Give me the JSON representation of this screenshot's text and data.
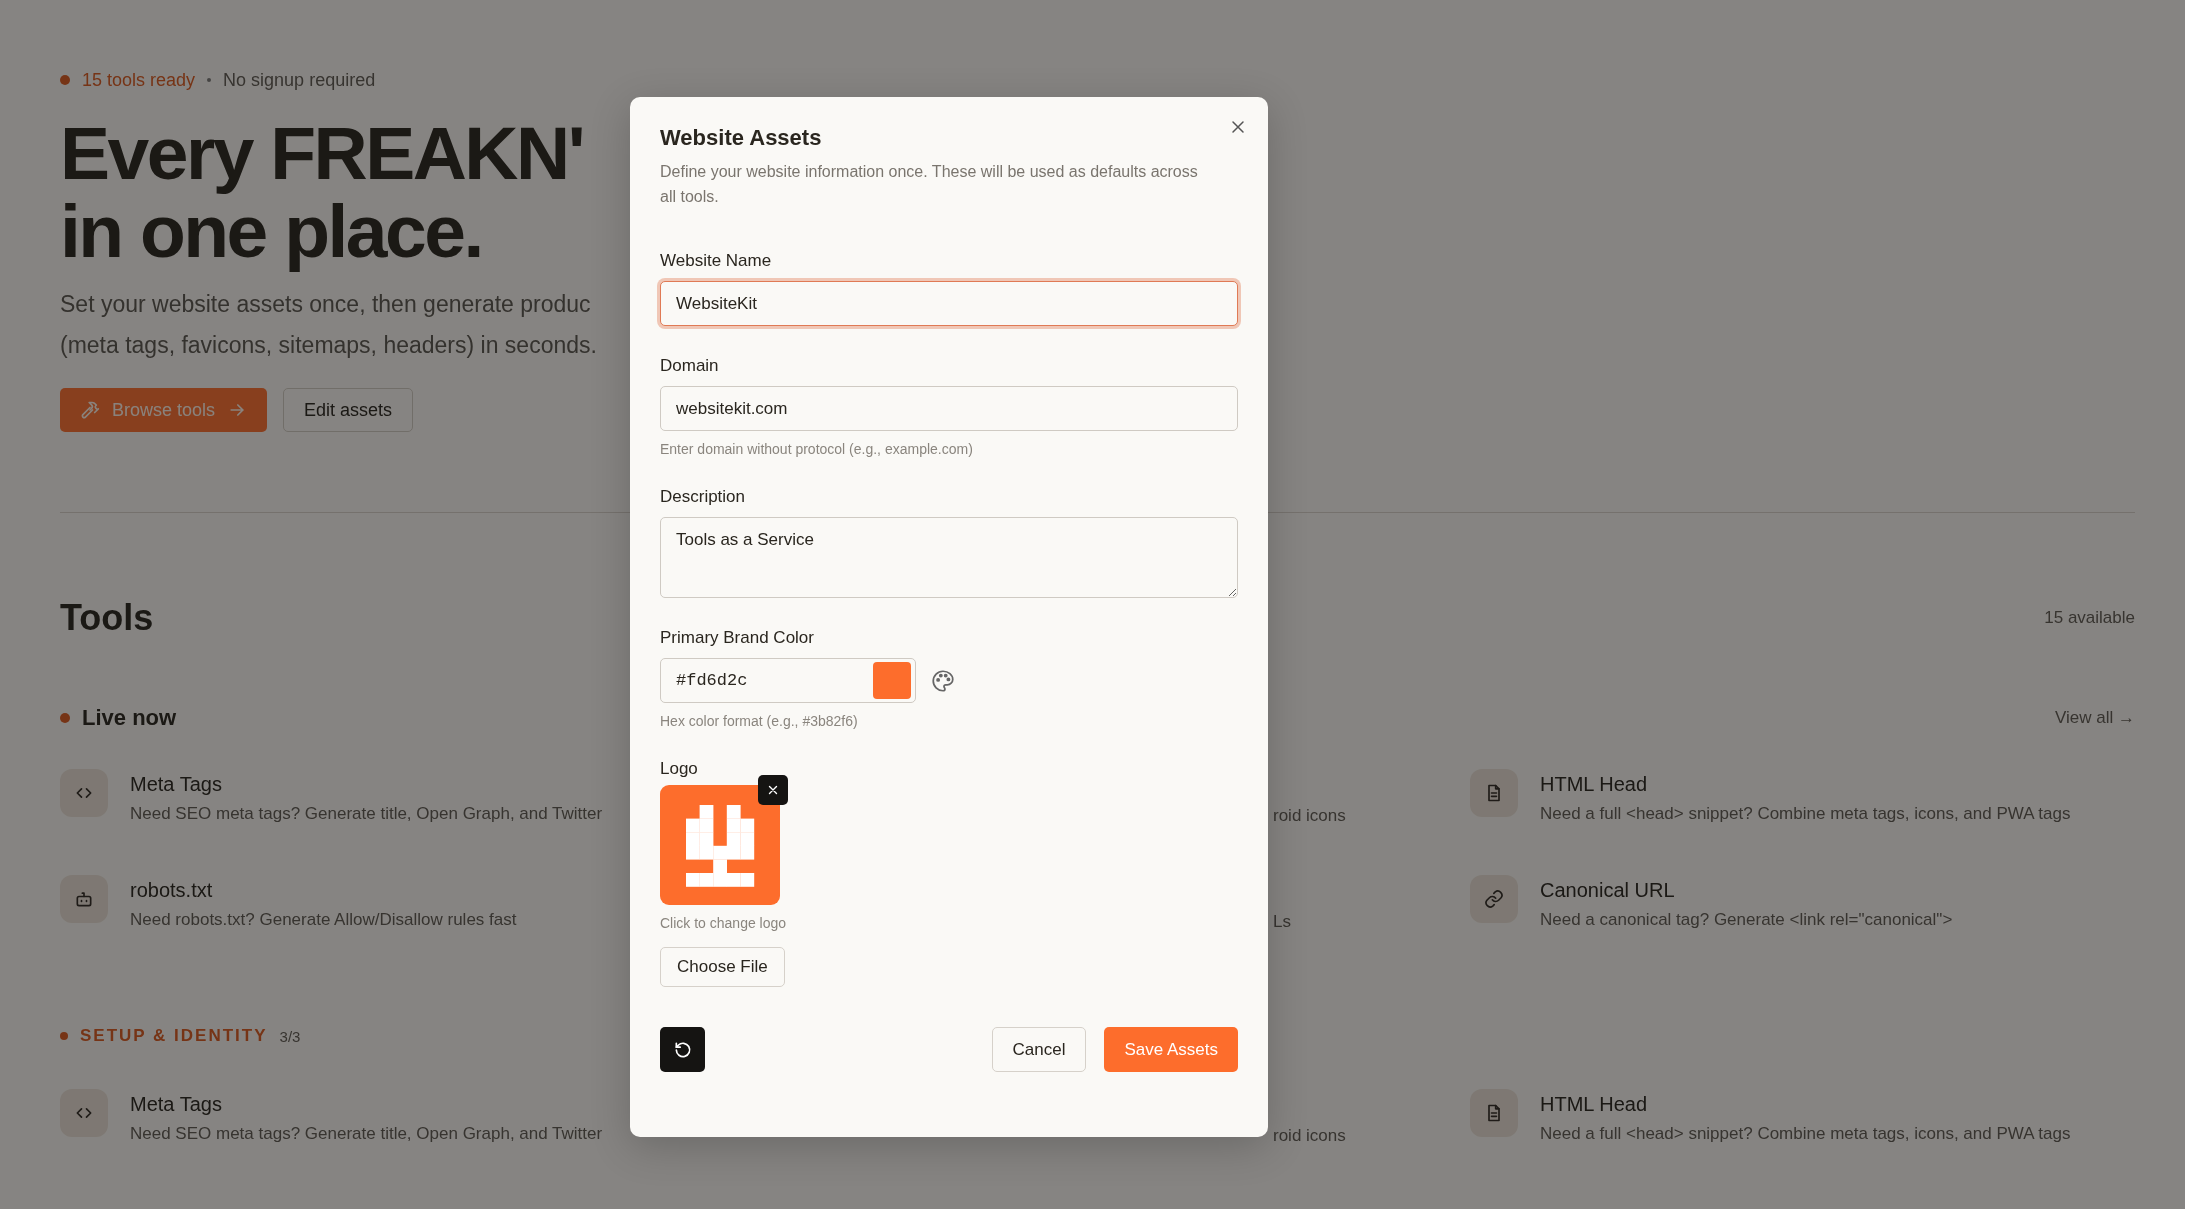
{
  "hero": {
    "status": "15 tools ready",
    "note": "No signup required",
    "heading_lines": [
      "Every FREAKN'",
      "in one place."
    ],
    "subtitle_lines": [
      "Set your website assets once, then generate produc",
      "(meta tags, favicons, sitemaps, headers) in seconds."
    ],
    "buttons": [
      {
        "label": "Browse tools",
        "kind": "primary"
      },
      {
        "label": "Edit assets",
        "kind": "secondary"
      }
    ]
  },
  "tools": {
    "title": "Tools",
    "count": "15 available",
    "sections": [
      {
        "kind": "live",
        "title": "Live now",
        "link": "View all →",
        "rows": [
          [
            {
              "kind": "code",
              "title": "Meta Tags",
              "description": "Need SEO meta tags? Generate title, Open Graph, and Twitter"
            },
            {
              "kind": "fragment",
              "description": "roid icons"
            },
            {
              "kind": "document",
              "title": "HTML Head",
              "description": "Need a full <head> snippet? Combine meta tags, icons, and PWA tags"
            }
          ],
          [
            {
              "kind": "robot",
              "title": "robots.txt",
              "description": "Need robots.txt? Generate Allow/Disallow rules fast"
            },
            {
              "kind": "fragment",
              "description": "Ls"
            },
            {
              "kind": "link",
              "title": "Canonical URL",
              "description": "Need a canonical tag? Generate <link rel=\"canonical\">"
            }
          ]
        ]
      },
      {
        "kind": "category",
        "title": "SETUP & IDENTITY",
        "count": "3/3",
        "rows": [
          [
            {
              "kind": "code",
              "title": "Meta Tags",
              "description": "Need SEO meta tags? Generate title, Open Graph, and Twitter"
            },
            {
              "kind": "fragment",
              "description": "roid icons"
            },
            {
              "kind": "document",
              "title": "HTML Head",
              "description": "Need a full <head> snippet? Combine meta tags, icons, and PWA tags"
            }
          ]
        ]
      }
    ]
  },
  "modal": {
    "title": "Website Assets",
    "description": "Define your website information once. These will be used as defaults across all tools.",
    "fields": [
      {
        "kind": "input",
        "label": "Website Name",
        "value": "WebsiteKit",
        "focused": true
      },
      {
        "kind": "input",
        "label": "Domain",
        "value": "websitekit.com",
        "focused": false,
        "hint": "Enter domain without protocol (e.g., example.com)"
      },
      {
        "kind": "textarea",
        "label": "Description",
        "value": "Tools as a Service",
        "focused": false
      },
      {
        "kind": "color",
        "label": "Primary Brand Color",
        "value": "#fd6d2c",
        "color": "#fd6d2c",
        "focused": false,
        "hint": "Hex color format (e.g., #3b82f6)"
      },
      {
        "kind": "logo",
        "label": "Logo",
        "hint": "Click to change logo",
        "button": "Choose File"
      }
    ],
    "buttons": [
      {
        "kind": "reset"
      },
      {
        "kind": "secondary",
        "label": "Cancel"
      },
      {
        "kind": "primary",
        "label": "Save Assets"
      }
    ]
  }
}
